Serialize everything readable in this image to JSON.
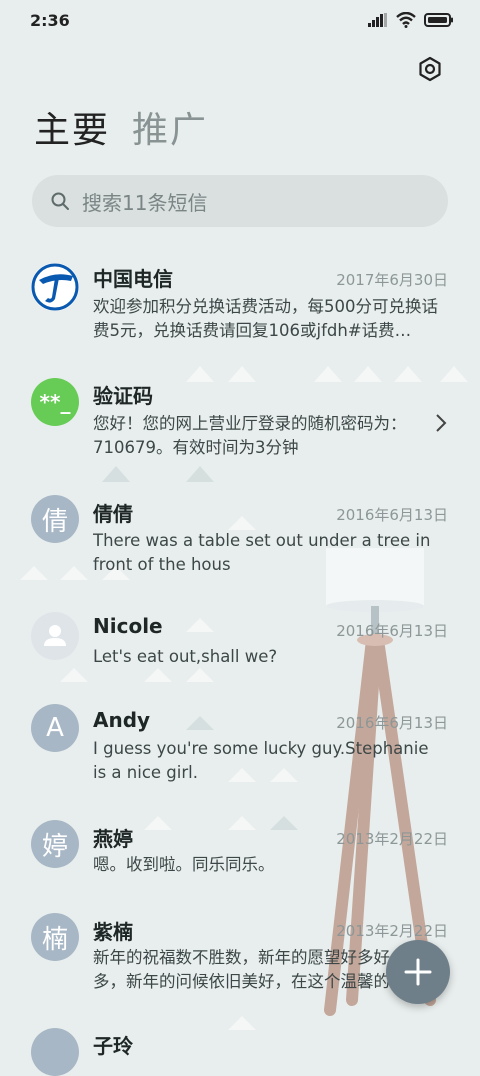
{
  "status_bar": {
    "time": "2:36"
  },
  "tabs": {
    "primary": "主要",
    "secondary": "推广"
  },
  "search": {
    "placeholder": "搜索11条短信"
  },
  "messages": [
    {
      "name": "中国电信",
      "date": "2017年6月30日",
      "preview": "欢迎参加积分兑换话费活动，每500分可兑换话费5元，兑换话费请回复106或jfdh#话费…",
      "avatar": "china-telecom-logo"
    },
    {
      "name": "验证码",
      "date": "",
      "preview": "您好！您的网上营业厅登录的随机密码为：710679。有效时间为3分钟",
      "avatar_text": "**_"
    },
    {
      "name": "倩倩",
      "date": "2016年6月13日",
      "preview": "There was a table set out under a tree in front of the hous",
      "avatar_text": "倩"
    },
    {
      "name": "Nicole",
      "date": "2016年6月13日",
      "preview": "Let's eat out,shall we?",
      "avatar": "person-icon"
    },
    {
      "name": "Andy",
      "date": "2016年6月13日",
      "preview": "I guess you're some lucky guy.Stephanie is a nice girl.",
      "avatar_text": "A"
    },
    {
      "name": "燕婷",
      "date": "2013年2月22日",
      "preview": "嗯。收到啦。同乐同乐。",
      "avatar_text": "婷"
    },
    {
      "name": "紫楠",
      "date": "2013年2月22日",
      "preview": "新年的祝福数不胜数，新年的愿望好多好多，新年的问候依旧美好，在这个温馨的时刻",
      "avatar_text": "楠"
    },
    {
      "name": "子玲",
      "date": "",
      "preview": "",
      "avatar_text": ""
    }
  ],
  "colors": {
    "background": "#e8eeed",
    "fab": "#6e7f8a",
    "telecom_blue": "#0a59b0",
    "code_green": "#66cc55"
  }
}
